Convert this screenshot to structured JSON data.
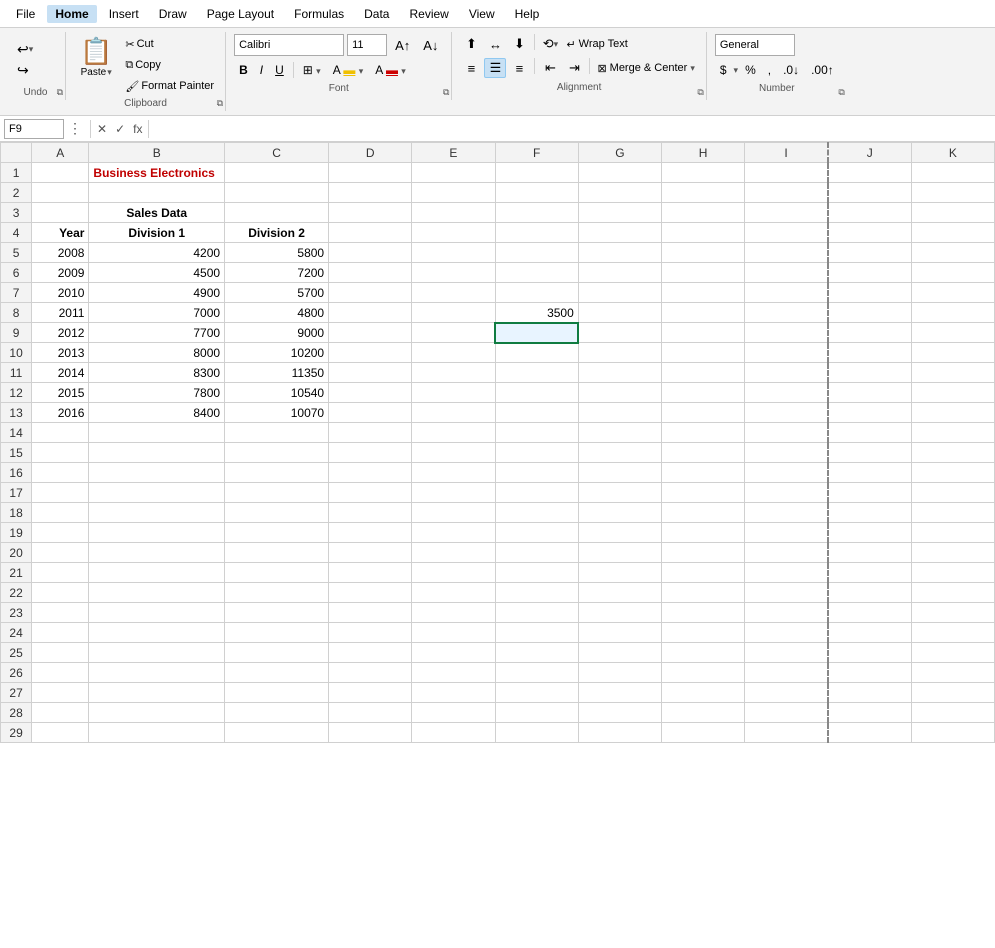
{
  "menu": {
    "items": [
      "File",
      "Home",
      "Insert",
      "Draw",
      "Page Layout",
      "Formulas",
      "Data",
      "Review",
      "View",
      "Help"
    ]
  },
  "ribbon": {
    "undo_label": "Undo",
    "clipboard_label": "Clipboard",
    "font_label": "Font",
    "alignment_label": "Alignment",
    "number_label": "Number",
    "paste_label": "Paste",
    "cut_label": "Cut",
    "copy_label": "Copy",
    "format_painter_label": "Format Painter",
    "font_name": "Calibri",
    "font_size": "11",
    "bold": "B",
    "italic": "I",
    "underline": "U",
    "wrap_text": "Wrap Text",
    "merge_center": "Merge & Center",
    "dollar": "$",
    "percent": "%",
    "comma": ",",
    "number_format": "General"
  },
  "formula_bar": {
    "cell_ref": "F9",
    "fx_label": "fx"
  },
  "columns": [
    "A",
    "B",
    "C",
    "D",
    "E",
    "F",
    "G",
    "H",
    "I",
    "J",
    "K"
  ],
  "rows": [
    {
      "num": 1,
      "cells": {
        "B": {
          "text": "Business Electronics",
          "class": "title-cell"
        }
      }
    },
    {
      "num": 2,
      "cells": {}
    },
    {
      "num": 3,
      "cells": {
        "B": {
          "text": "Sales Data",
          "class": "header-cell"
        }
      }
    },
    {
      "num": 4,
      "cells": {
        "A": {
          "text": "Year",
          "class": "label-cell"
        },
        "B": {
          "text": "Division 1",
          "class": "header-cell"
        },
        "C": {
          "text": "Division 2",
          "class": "header-cell"
        }
      }
    },
    {
      "num": 5,
      "cells": {
        "A": {
          "text": "2008",
          "class": "year-cell"
        },
        "B": {
          "text": "4200",
          "class": "num-cell"
        },
        "C": {
          "text": "5800",
          "class": "num-cell"
        }
      }
    },
    {
      "num": 6,
      "cells": {
        "A": {
          "text": "2009",
          "class": "year-cell"
        },
        "B": {
          "text": "4500",
          "class": "num-cell"
        },
        "C": {
          "text": "7200",
          "class": "num-cell"
        }
      }
    },
    {
      "num": 7,
      "cells": {
        "A": {
          "text": "2010",
          "class": "year-cell"
        },
        "B": {
          "text": "4900",
          "class": "num-cell"
        },
        "C": {
          "text": "5700",
          "class": "num-cell"
        }
      }
    },
    {
      "num": 8,
      "cells": {
        "A": {
          "text": "2011",
          "class": "year-cell"
        },
        "B": {
          "text": "7000",
          "class": "num-cell"
        },
        "C": {
          "text": "4800",
          "class": "num-cell"
        },
        "F": {
          "text": "3500",
          "class": "num-cell"
        }
      }
    },
    {
      "num": 9,
      "cells": {
        "A": {
          "text": "2012",
          "class": "year-cell"
        },
        "B": {
          "text": "7700",
          "class": "num-cell"
        },
        "C": {
          "text": "9000",
          "class": "num-cell"
        }
      }
    },
    {
      "num": 10,
      "cells": {
        "A": {
          "text": "2013",
          "class": "year-cell"
        },
        "B": {
          "text": "8000",
          "class": "num-cell"
        },
        "C": {
          "text": "10200",
          "class": "num-cell"
        }
      }
    },
    {
      "num": 11,
      "cells": {
        "A": {
          "text": "2014",
          "class": "year-cell"
        },
        "B": {
          "text": "8300",
          "class": "num-cell"
        },
        "C": {
          "text": "11350",
          "class": "num-cell"
        }
      }
    },
    {
      "num": 12,
      "cells": {
        "A": {
          "text": "2015",
          "class": "year-cell"
        },
        "B": {
          "text": "7800",
          "class": "num-cell"
        },
        "C": {
          "text": "10540",
          "class": "num-cell"
        }
      }
    },
    {
      "num": 13,
      "cells": {
        "A": {
          "text": "2016",
          "class": "year-cell"
        },
        "B": {
          "text": "8400",
          "class": "num-cell"
        },
        "C": {
          "text": "10070",
          "class": "num-cell"
        }
      }
    },
    {
      "num": 14,
      "cells": {}
    },
    {
      "num": 15,
      "cells": {}
    },
    {
      "num": 16,
      "cells": {}
    },
    {
      "num": 17,
      "cells": {}
    },
    {
      "num": 18,
      "cells": {}
    },
    {
      "num": 19,
      "cells": {}
    },
    {
      "num": 20,
      "cells": {}
    },
    {
      "num": 21,
      "cells": {}
    },
    {
      "num": 22,
      "cells": {}
    },
    {
      "num": 23,
      "cells": {}
    },
    {
      "num": 24,
      "cells": {}
    },
    {
      "num": 25,
      "cells": {}
    },
    {
      "num": 26,
      "cells": {}
    },
    {
      "num": 27,
      "cells": {}
    },
    {
      "num": 28,
      "cells": {}
    },
    {
      "num": 29,
      "cells": {}
    }
  ],
  "selected_cell": {
    "row": 9,
    "col": "F"
  }
}
